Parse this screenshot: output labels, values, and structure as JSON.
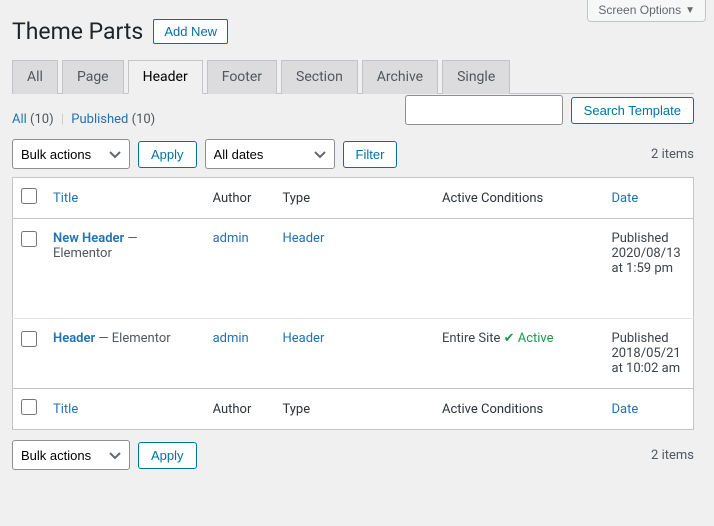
{
  "screen_options_label": "Screen Options",
  "page_title": "Theme Parts",
  "add_new_label": "Add New",
  "tabs": [
    "All",
    "Page",
    "Header",
    "Footer",
    "Section",
    "Archive",
    "Single"
  ],
  "active_tab_index": 2,
  "views": {
    "all_label": "All",
    "all_count": "(10)",
    "published_label": "Published",
    "published_count": "(10)"
  },
  "search": {
    "button": "Search Template"
  },
  "bulk_actions_label": "Bulk actions",
  "apply_label": "Apply",
  "all_dates_label": "All dates",
  "filter_label": "Filter",
  "items_count": "2 items",
  "columns": {
    "title": "Title",
    "author": "Author",
    "type": "Type",
    "conditions": "Active Conditions",
    "date": "Date"
  },
  "rows": [
    {
      "title": "New Header",
      "title_suffix": " — Elementor",
      "author": "admin",
      "type": "Header",
      "condition_text": "",
      "condition_badge": "",
      "date_status": "Published",
      "date_line1": "2020/08/13",
      "date_line2": "at 1:59 pm"
    },
    {
      "title": "Header",
      "title_suffix": " — Elementor",
      "author": "admin",
      "type": "Header",
      "condition_text": "Entire Site",
      "condition_badge": "Active",
      "date_status": "Published",
      "date_line1": "2018/05/21",
      "date_line2": "at 10:02 am"
    }
  ]
}
